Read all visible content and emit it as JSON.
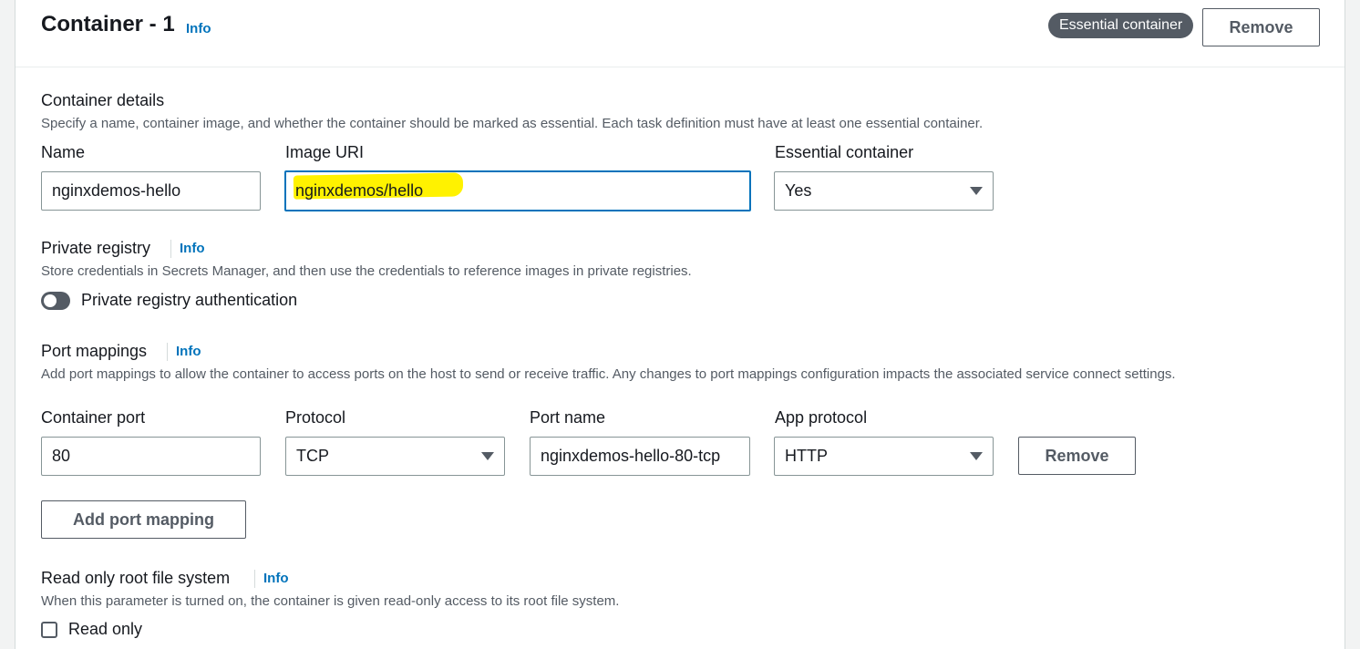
{
  "header": {
    "title": "Container - 1",
    "info_label": "Info",
    "badge": "Essential container",
    "remove_label": "Remove"
  },
  "container_details": {
    "title": "Container details",
    "description": "Specify a name, container image, and whether the container should be marked as essential. Each task definition must have at least one essential container.",
    "name_label": "Name",
    "name_value": "nginxdemos-hello",
    "image_label": "Image URI",
    "image_value": "nginxdemos/hello",
    "essential_label": "Essential container",
    "essential_value": "Yes"
  },
  "private_registry": {
    "title": "Private registry",
    "info_label": "Info",
    "description": "Store credentials in Secrets Manager, and then use the credentials to reference images in private registries.",
    "toggle_label": "Private registry authentication"
  },
  "port_mappings": {
    "title": "Port mappings",
    "info_label": "Info",
    "description": "Add port mappings to allow the container to access ports on the host to send or receive traffic. Any changes to port mappings configuration impacts the associated service connect settings.",
    "container_port_label": "Container port",
    "container_port_value": "80",
    "protocol_label": "Protocol",
    "protocol_value": "TCP",
    "port_name_label": "Port name",
    "port_name_value": "nginxdemos-hello-80-tcp",
    "app_protocol_label": "App protocol",
    "app_protocol_value": "HTTP",
    "remove_label": "Remove",
    "add_label": "Add port mapping"
  },
  "readonly_fs": {
    "title": "Read only root file system",
    "info_label": "Info",
    "description": "When this parameter is turned on, the container is given read-only access to its root file system.",
    "checkbox_label": "Read only"
  },
  "colors": {
    "accent": "#0073bb",
    "highlight": "#fff200",
    "badge_bg": "#545b64"
  }
}
